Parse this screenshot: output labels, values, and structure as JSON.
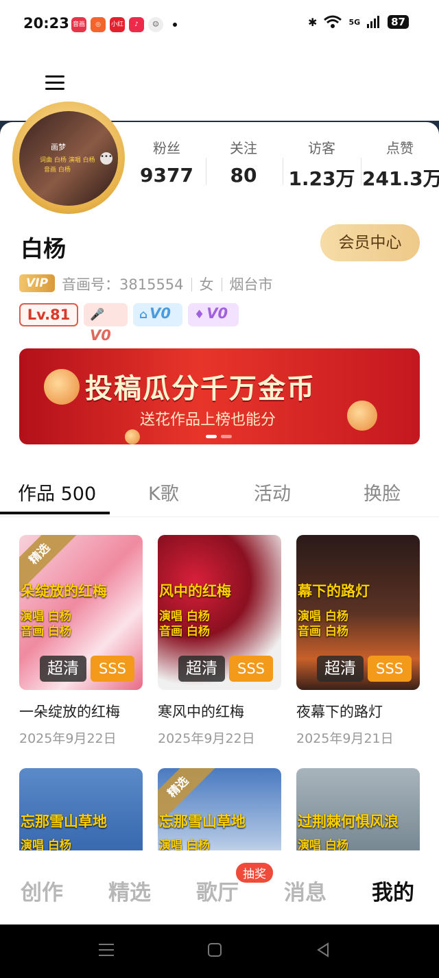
{
  "status_bar": {
    "time": "20:23",
    "apps": [
      {
        "icon": "app-icon-1",
        "color": "#e8334a",
        "label": "音画"
      },
      {
        "icon": "app-icon-2",
        "color": "#f5642a",
        "label": ""
      },
      {
        "icon": "app-icon-3",
        "color": "#e5202e",
        "label": "小红书"
      },
      {
        "icon": "app-icon-4",
        "color": "#ee2a4a",
        "label": ""
      }
    ],
    "network": "5G",
    "battery": "87"
  },
  "profile": {
    "avatar_text": {
      "title": "画梦",
      "line1": "词曲 白杨 演唱 白杨",
      "line2": "音画 白杨"
    },
    "stats": [
      {
        "label": "粉丝",
        "value": "9377"
      },
      {
        "label": "关注",
        "value": "80"
      },
      {
        "label": "访客",
        "value": "1.23万"
      },
      {
        "label": "点赞",
        "value": "241.3万"
      }
    ],
    "name": "白杨",
    "member_center": "会员中心",
    "vip": "VIP",
    "id_label": "音画号：3815554",
    "gender": "女",
    "city": "烟台市",
    "level": "Lv.81",
    "badges": [
      "V0",
      "V0",
      "V0"
    ]
  },
  "banner": {
    "title": "投稿瓜分千万金币",
    "subtitle": "送花作品上榜也能分"
  },
  "tabs": [
    {
      "label": "作品 500",
      "active": true
    },
    {
      "label": "K歌",
      "active": false
    },
    {
      "label": "活动",
      "active": false
    },
    {
      "label": "换脸",
      "active": false
    }
  ],
  "works": [
    {
      "thumb_title": "朵绽放的红梅",
      "singer": "演唱 白杨",
      "art": "音画 白杨",
      "hd": "超清",
      "grade": "SSS",
      "pick": "精选",
      "title": "一朵绽放的红梅",
      "date": "2025年9月22日"
    },
    {
      "thumb_title": "风中的红梅",
      "singer": "演唱 白杨",
      "art": "音画 白杨",
      "hd": "超清",
      "grade": "SSS",
      "pick": "",
      "title": "寒风中的红梅",
      "date": "2025年9月22日"
    },
    {
      "thumb_title": "幕下的路灯",
      "singer": "演唱 白杨",
      "art": "音画 白杨",
      "hd": "超清",
      "grade": "SSS",
      "pick": "",
      "title": "夜幕下的路灯",
      "date": "2025年9月21日"
    },
    {
      "thumb_title": "忘那雪山草地",
      "singer": "演唱 白杨",
      "pick": ""
    },
    {
      "thumb_title": "忘那雪山草地",
      "singer": "演唱 白杨",
      "pick": "精选"
    },
    {
      "thumb_title": "过荆棘何惧风浪",
      "singer": "演唱 白杨",
      "pick": ""
    }
  ],
  "bottom_nav": [
    {
      "label": "创作",
      "active": false
    },
    {
      "label": "精选",
      "active": false
    },
    {
      "label": "歌厅",
      "active": false
    },
    {
      "label": "消息",
      "active": false
    },
    {
      "label": "我的",
      "active": true
    }
  ],
  "lottery_badge": "抽奖",
  "system_nav": [
    "menu-icon",
    "home-icon",
    "back-icon"
  ]
}
